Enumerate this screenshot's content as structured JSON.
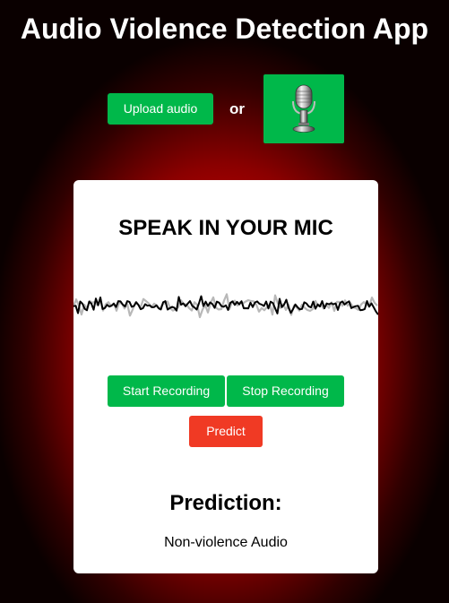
{
  "header": {
    "title": "Audio Violence Detection App"
  },
  "upload": {
    "button_label": "Upload audio",
    "separator": "or",
    "mic_icon": "microphone-icon"
  },
  "card": {
    "title": "SPEAK IN YOUR MIC",
    "waveform_icon": "audio-waveform",
    "start_label": "Start Recording",
    "stop_label": "Stop Recording",
    "predict_label": "Predict",
    "prediction_heading": "Prediction:",
    "prediction_result": "Non-violence Audio"
  },
  "colors": {
    "accent_green": "#00b84a",
    "predict_red": "#f03a24",
    "background_red": "#e00000"
  }
}
